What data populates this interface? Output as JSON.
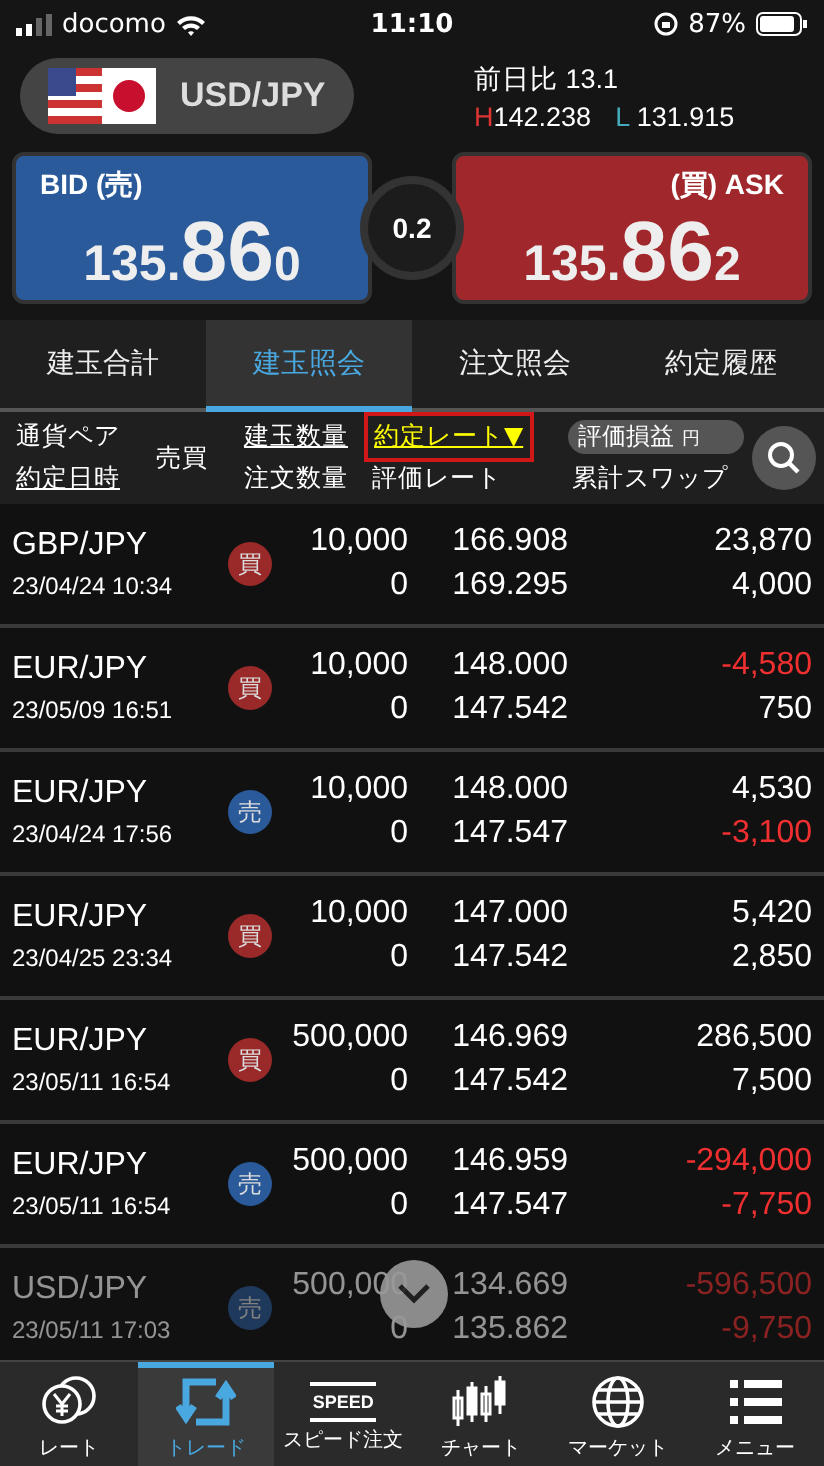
{
  "status_bar": {
    "carrier": "docomo",
    "time": "11:10",
    "battery": "87%"
  },
  "pair": {
    "label": "USD/JPY"
  },
  "stats": {
    "change_label": "前日比",
    "change": "13.1",
    "high_label": "H",
    "high": "142.238",
    "low_label": "L",
    "low": "131.915"
  },
  "bid": {
    "label": "BID (売)",
    "price_head": "135.",
    "price_big": "86",
    "price_tail": "0"
  },
  "spread": "0.2",
  "ask": {
    "label": "(買) ASK",
    "price_head": "135.",
    "price_big": "86",
    "price_tail": "2"
  },
  "tabs": [
    {
      "label": "建玉合計",
      "selected": false
    },
    {
      "label": "建玉照会",
      "selected": true
    },
    {
      "label": "注文照会",
      "selected": false
    },
    {
      "label": "約定履歴",
      "selected": false
    }
  ],
  "column_headers": {
    "pair": {
      "label": "通貨ペア",
      "underlined": false
    },
    "date": {
      "label": "約定日時",
      "underlined": true
    },
    "side": {
      "label": "売買",
      "underlined": false
    },
    "qty": {
      "label": "建玉数量",
      "underlined": true
    },
    "order_qty": {
      "label": "注文数量",
      "underlined": false
    },
    "rate": {
      "label": "約定レート▼",
      "underlined": true,
      "selected": true
    },
    "eval_rate": {
      "label": "評価レート",
      "underlined": false
    },
    "pl": {
      "label": "評価損益",
      "unit": "円"
    },
    "swap": {
      "label": "累計スワップ",
      "underlined": false
    }
  },
  "rows": [
    {
      "pair": "GBP/JPY",
      "date": "23/04/24 10:34",
      "side": {
        "label": "買",
        "kind": "buy"
      },
      "qty": "10,000",
      "order_qty": "0",
      "rate": "166.908",
      "eval_rate": "169.295",
      "pl": "23,870",
      "pl_negative": false,
      "swap": "4,000",
      "swap_negative": false,
      "faded": false
    },
    {
      "pair": "EUR/JPY",
      "date": "23/05/09 16:51",
      "side": {
        "label": "買",
        "kind": "buy"
      },
      "qty": "10,000",
      "order_qty": "0",
      "rate": "148.000",
      "eval_rate": "147.542",
      "pl": "-4,580",
      "pl_negative": true,
      "swap": "750",
      "swap_negative": false,
      "faded": false
    },
    {
      "pair": "EUR/JPY",
      "date": "23/04/24 17:56",
      "side": {
        "label": "売",
        "kind": "sell"
      },
      "qty": "10,000",
      "order_qty": "0",
      "rate": "148.000",
      "eval_rate": "147.547",
      "pl": "4,530",
      "pl_negative": false,
      "swap": "-3,100",
      "swap_negative": true,
      "faded": false
    },
    {
      "pair": "EUR/JPY",
      "date": "23/04/25 23:34",
      "side": {
        "label": "買",
        "kind": "buy"
      },
      "qty": "10,000",
      "order_qty": "0",
      "rate": "147.000",
      "eval_rate": "147.542",
      "pl": "5,420",
      "pl_negative": false,
      "swap": "2,850",
      "swap_negative": false,
      "faded": false
    },
    {
      "pair": "EUR/JPY",
      "date": "23/05/11 16:54",
      "side": {
        "label": "買",
        "kind": "buy"
      },
      "qty": "500,000",
      "order_qty": "0",
      "rate": "146.969",
      "eval_rate": "147.542",
      "pl": "286,500",
      "pl_negative": false,
      "swap": "7,500",
      "swap_negative": false,
      "faded": false
    },
    {
      "pair": "EUR/JPY",
      "date": "23/05/11 16:54",
      "side": {
        "label": "売",
        "kind": "sell"
      },
      "qty": "500,000",
      "order_qty": "0",
      "rate": "146.959",
      "eval_rate": "147.547",
      "pl": "-294,000",
      "pl_negative": true,
      "swap": "-7,750",
      "swap_negative": true,
      "faded": false
    },
    {
      "pair": "USD/JPY",
      "date": "23/05/11 17:03",
      "side": {
        "label": "売",
        "kind": "sell"
      },
      "qty": "500,000",
      "order_qty": "0",
      "rate": "134.669",
      "eval_rate": "135.862",
      "pl": "-596,500",
      "pl_negative": true,
      "swap": "-9,750",
      "swap_negative": true,
      "faded": true
    }
  ],
  "nav": [
    {
      "label": "レート",
      "kind": "rate",
      "selected": false
    },
    {
      "label": "トレード",
      "kind": "trade",
      "selected": true
    },
    {
      "label": "スピード注文",
      "kind": "speed",
      "icon_text": "SPEED",
      "selected": false
    },
    {
      "label": "チャート",
      "kind": "chart",
      "selected": false
    },
    {
      "label": "マーケット",
      "kind": "market",
      "selected": false
    },
    {
      "label": "メニュー",
      "kind": "menu",
      "selected": false
    }
  ]
}
